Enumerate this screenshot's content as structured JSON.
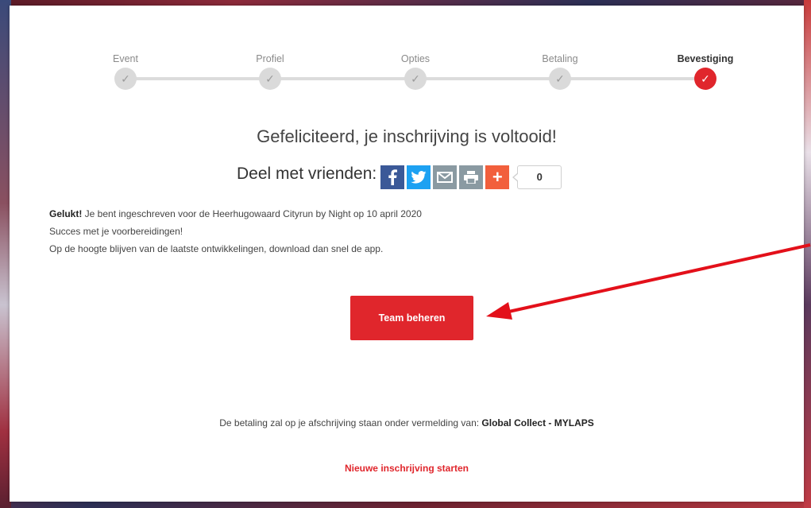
{
  "steps": [
    {
      "label": "Event",
      "state": "done"
    },
    {
      "label": "Profiel",
      "state": "done"
    },
    {
      "label": "Opties",
      "state": "done"
    },
    {
      "label": "Betaling",
      "state": "done"
    },
    {
      "label": "Bevestiging",
      "state": "active"
    }
  ],
  "step_check": "✓",
  "headline": "Gefeliciteerd, je inschrijving is voltooid!",
  "share": {
    "label": "Deel met vrienden:",
    "count": "0",
    "buttons": [
      "facebook-icon",
      "twitter-icon",
      "email-icon",
      "print-icon",
      "add-icon"
    ]
  },
  "info": {
    "line1_bold": "Gelukt!",
    "line1_rest": " Je bent ingeschreven voor de Heerhugowaard Cityrun by Night op 10 april 2020",
    "line2": "Succes met je voorbereidingen!",
    "line3": "Op de hoogte blijven van de laatste ontwikkelingen, download dan snel de app."
  },
  "team_button": "Team beheren",
  "payment": {
    "text": "De betaling zal op je afschrijving staan onder vermelding van: ",
    "bold": "Global Collect - MYLAPS"
  },
  "new_registration": "Nieuwe inschrijving starten",
  "colors": {
    "accent": "#e0262c",
    "facebook": "#3b5998",
    "twitter": "#1da1f2",
    "annotation_arrow": "#e3101a"
  }
}
